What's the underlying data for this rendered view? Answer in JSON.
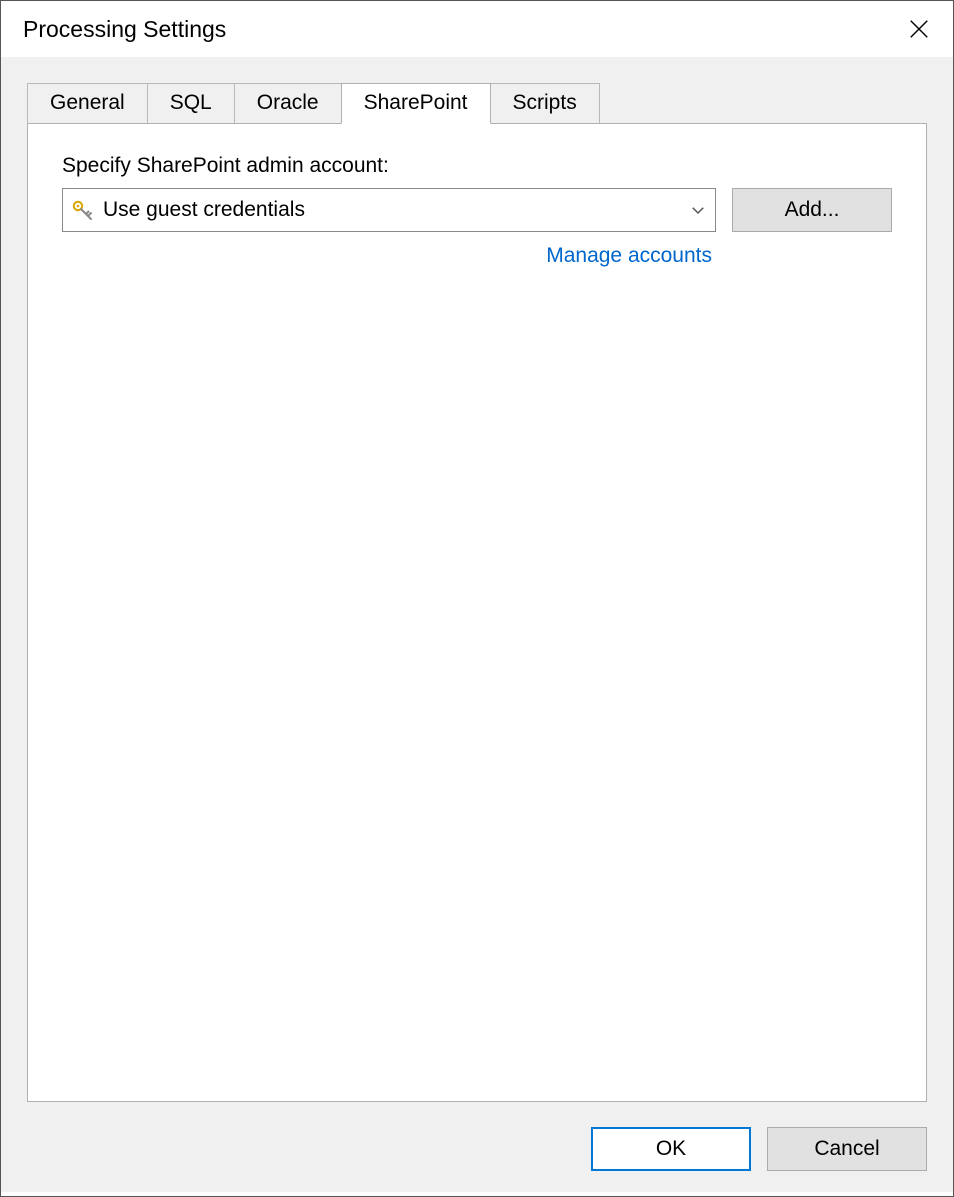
{
  "dialog": {
    "title": "Processing Settings"
  },
  "tabs": [
    {
      "label": "General",
      "active": false
    },
    {
      "label": "SQL",
      "active": false
    },
    {
      "label": "Oracle",
      "active": false
    },
    {
      "label": "SharePoint",
      "active": true
    },
    {
      "label": "Scripts",
      "active": false
    }
  ],
  "sharepoint": {
    "field_label": "Specify SharePoint admin account:",
    "account_selected": "Use guest credentials",
    "add_button": "Add...",
    "manage_link": "Manage accounts"
  },
  "footer": {
    "ok": "OK",
    "cancel": "Cancel"
  }
}
